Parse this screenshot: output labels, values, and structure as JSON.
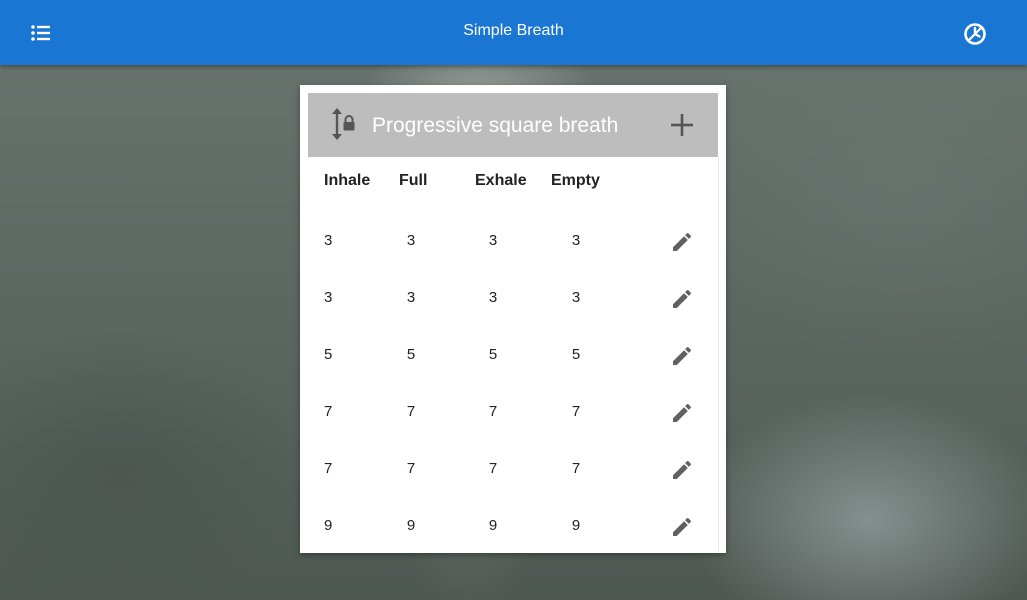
{
  "app_bar": {
    "title": "Simple Breath",
    "left_icon": "list-menu-icon",
    "right_icon": "timer-icon",
    "color": "#1976d2"
  },
  "card": {
    "title": "Progressive square breath",
    "header_color": "#bdbdbd",
    "lock_icon": "vertical-arrows-lock-icon",
    "add_icon": "plus-icon",
    "edit_icon": "pencil-icon",
    "columns": [
      "Inhale",
      "Full",
      "Exhale",
      "Empty"
    ],
    "rows": [
      {
        "inhale": "3",
        "full": "3",
        "exhale": "3",
        "empty": "3"
      },
      {
        "inhale": "3",
        "full": "3",
        "exhale": "3",
        "empty": "3"
      },
      {
        "inhale": "5",
        "full": "5",
        "exhale": "5",
        "empty": "5"
      },
      {
        "inhale": "7",
        "full": "7",
        "exhale": "7",
        "empty": "7"
      },
      {
        "inhale": "7",
        "full": "7",
        "exhale": "7",
        "empty": "7"
      },
      {
        "inhale": "9",
        "full": "9",
        "exhale": "9",
        "empty": "9"
      }
    ]
  }
}
